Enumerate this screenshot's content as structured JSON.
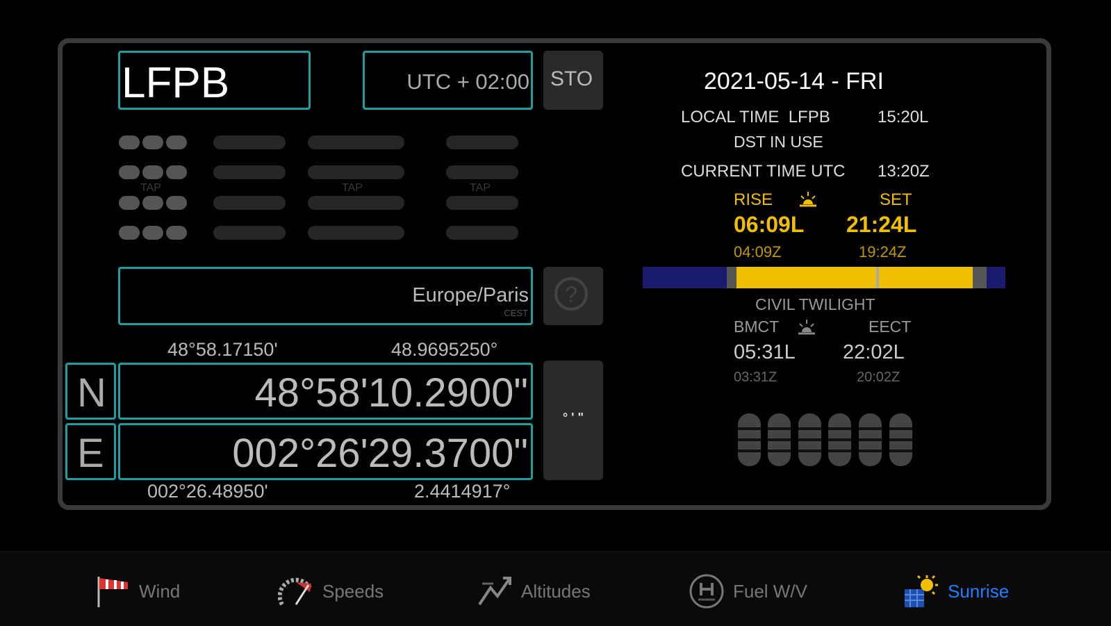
{
  "airport": {
    "code": "LFPB"
  },
  "utc": {
    "offset": "UTC + 02:00",
    "store_label": "STO"
  },
  "grid": {
    "tap_labels": [
      "TAP",
      "TAP",
      "TAP"
    ]
  },
  "timezone": {
    "name": "Europe/Paris",
    "abbr": "CEST",
    "help_label": "?"
  },
  "coords": {
    "lat_dm": "48°58.17150'",
    "lat_dd": "48.9695250°",
    "lat_hemi": "N",
    "lat_dms": "48°58'10.2900\"",
    "lon_hemi": "E",
    "lon_dms": "002°26'29.3700\"",
    "lon_dm": "002°26.48950'",
    "lon_dd": "2.4414917°",
    "format_label": "° ' \""
  },
  "info": {
    "date": "2021-05-14 - FRI",
    "local_time_label": "LOCAL TIME  LFPB",
    "local_time": "15:20L",
    "dst": "DST IN USE",
    "utc_label": "CURRENT TIME UTC",
    "utc_time": "13:20Z"
  },
  "sun": {
    "rise_label": "RISE",
    "set_label": "SET",
    "rise_local": "06:09L",
    "set_local": "21:24L",
    "rise_utc": "04:09Z",
    "set_utc": "19:24Z",
    "twilight_label": "CIVIL TWILIGHT",
    "bmct_label": "BMCT",
    "eect_label": "EECT",
    "bmct_local": "05:31L",
    "eect_local": "22:02L",
    "bmct_utc": "03:31Z",
    "eect_utc": "20:02Z"
  },
  "colors": {
    "accent": "#1aa0a0",
    "daylight": "#f0c000",
    "night": "#1a1a6e",
    "active_tab": "#1e7fff"
  },
  "tabs": [
    {
      "label": "Wind",
      "icon": "windsock-icon"
    },
    {
      "label": "Speeds",
      "icon": "speeds-icon"
    },
    {
      "label": "Altitudes",
      "icon": "altitudes-icon"
    },
    {
      "label": "Fuel W/V",
      "icon": "fuel-icon"
    },
    {
      "label": "Sunrise",
      "icon": "sunrise-icon",
      "active": true
    }
  ]
}
